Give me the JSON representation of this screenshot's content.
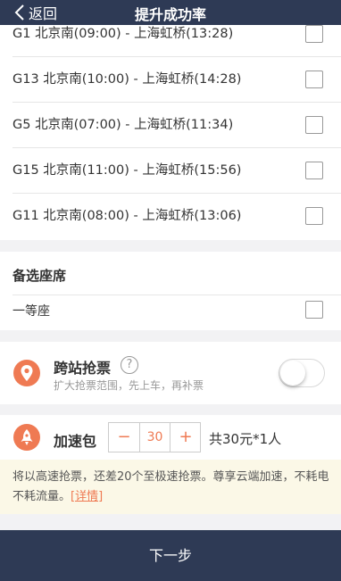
{
  "nav": {
    "back_label": "返回",
    "title": "提升成功率"
  },
  "trains": [
    {
      "text": "G1  北京南(09:00) - 上海虹桥(13:28)"
    },
    {
      "text": "G13  北京南(10:00) - 上海虹桥(14:28)"
    },
    {
      "text": "G5  北京南(07:00) - 上海虹桥(11:34)"
    },
    {
      "text": "G15  北京南(11:00) - 上海虹桥(15:56)"
    },
    {
      "text": "G11  北京南(08:00) - 上海虹桥(13:06)"
    }
  ],
  "seat": {
    "header": "备选座席",
    "option": "一等座"
  },
  "cross_station": {
    "title": "跨站抢票",
    "help": "?",
    "subtitle": "扩大抢票范围，先上车，再补票"
  },
  "speed_pack": {
    "title": "加速包",
    "minus": "−",
    "plus": "+",
    "value": "30",
    "total": "共30元*1人"
  },
  "notice": {
    "text": "将以高速抢票，还差20个至极速抢票。尊享云端加速，不耗电不耗流量。",
    "link": "[详情]"
  },
  "footer": {
    "next_label": "下一步"
  },
  "colors": {
    "navy": "#2e3a55",
    "accent": "#ef7a53",
    "notice_bg": "#fbf8e7"
  }
}
